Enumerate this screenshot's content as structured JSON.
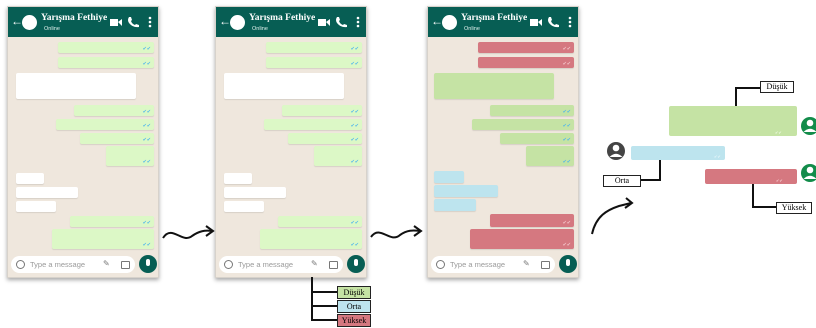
{
  "chat": {
    "contact_name": "Yarışma Fethiye",
    "status": "Online",
    "input_placeholder": "Type a message"
  },
  "legend": {
    "low": "Düşük",
    "medium": "Orta",
    "high": "Yüksek"
  },
  "levels": {
    "low_color": "#c5e3a4",
    "medium_color": "#bde4ee",
    "high_color": "#d57880"
  },
  "icons": [
    "back-arrow-icon",
    "video-icon",
    "phone-icon",
    "more-icon",
    "smiley-icon",
    "attach-icon",
    "camera-icon",
    "mic-icon",
    "user-icon",
    "curved-arrow-icon"
  ]
}
